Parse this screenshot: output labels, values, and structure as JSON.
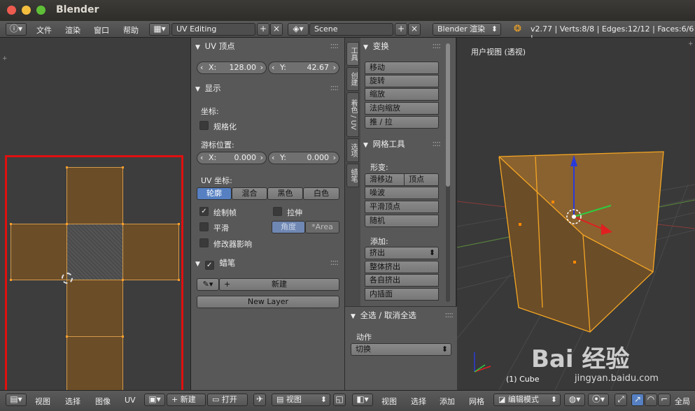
{
  "window": {
    "title": "Blender"
  },
  "info_header": {
    "menus": [
      "文件",
      "渲染",
      "窗口",
      "帮助"
    ],
    "layout_name": "UV Editing",
    "scene_name": "Scene",
    "render_engine": "Blender 渲染",
    "stats": "v2.77 | Verts:8/8 | Edges:12/12 | Faces:6/6 |"
  },
  "uv_vertex_panel": {
    "title": "UV 顶点",
    "x_label": "X:",
    "x_value": "128.00",
    "y_label": "Y:",
    "y_value": "42.67"
  },
  "display_panel": {
    "title": "显示",
    "coords_label": "坐标:",
    "normalized_label": "规格化",
    "cursor_label": "游标位置:",
    "cursor_x_label": "X:",
    "cursor_x": "0.000",
    "cursor_y_label": "Y:",
    "cursor_y": "0.000",
    "uv_coords_label": "UV 坐标:",
    "uv_modes": [
      "轮廓",
      "混合",
      "黑色",
      "白色"
    ],
    "draw_faces_label": "绘制帧",
    "stretch_label": "拉伸",
    "smooth_label": "平滑",
    "angle_label": "角度",
    "area_label": "*Area",
    "modifier_label": "修改器影响"
  },
  "grease_panel": {
    "title": "蜡笔",
    "new_label": "新建",
    "new_layer_label": "New Layer"
  },
  "shelf_tabs": [
    "工具",
    "创建",
    "着色 / UV",
    "选项",
    "蜡笔"
  ],
  "transform_panel": {
    "title": "变换",
    "buttons": [
      "移动",
      "旋转",
      "缩放",
      "法向缩放",
      "推 / 拉"
    ]
  },
  "mesh_tools_panel": {
    "title": "网格工具",
    "deform_label": "形变:",
    "slide_edge": "滑移边",
    "vertex": "顶点",
    "buttons": [
      "噪波",
      "平滑顶点",
      "随机"
    ],
    "add_label": "添加:",
    "extrude_dropdown": "挤出",
    "add_buttons": [
      "整体挤出",
      "各自挤出",
      "内插面"
    ]
  },
  "last_operator": {
    "title": "全选 / 取消全选",
    "action_label": "动作",
    "action_value": "切换"
  },
  "viewport": {
    "view_label": "用户视图 (透视)",
    "object_label": "(1) Cube"
  },
  "uv_header": {
    "menus": [
      "视图",
      "选择",
      "图像",
      "UV"
    ],
    "new_label": "新建",
    "open_label": "打开",
    "view_dropdown": "视图"
  },
  "viewport_header": {
    "menus": [
      "视图",
      "选择",
      "添加",
      "网格"
    ],
    "mode_dropdown": "编辑模式",
    "global_label": "全局"
  },
  "watermark": {
    "text": "Bai 经验",
    "url": "jingyan.baidu.com"
  },
  "colors": {
    "selection_box": "#e01010",
    "mesh_orange": "#f5a623",
    "face_brown": "#6b4d28"
  }
}
